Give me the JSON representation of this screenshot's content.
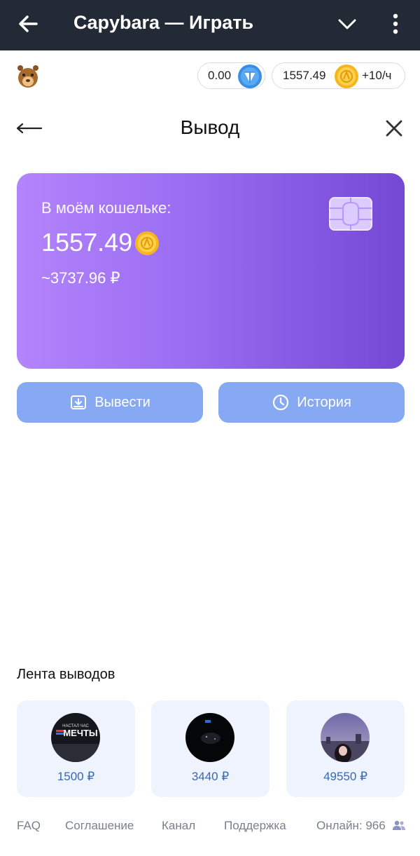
{
  "appbar": {
    "title": "Capybara — Играть"
  },
  "balances": {
    "ton": "0.00",
    "coins": "1557.49",
    "rate": "+10/ч"
  },
  "section": {
    "title": "Вывод"
  },
  "wallet": {
    "label": "В моём кошельке:",
    "amount": "1557.49",
    "rub": "~3737.96 ₽"
  },
  "actions": {
    "withdraw": "Вывести",
    "history": "История"
  },
  "feed": {
    "title": "Лента выводов",
    "items": [
      {
        "amount": "1500 ₽",
        "avatar_text_top": "НАСТАЛ ЧАС",
        "avatar_text": "МЕЧТЫ"
      },
      {
        "amount": "3440 ₽"
      },
      {
        "amount": "49550 ₽"
      }
    ]
  },
  "footer": {
    "faq": "FAQ",
    "agreement": "Соглашение",
    "channel": "Канал",
    "support": "Поддержка",
    "online": "Онлайн: 966"
  },
  "colors": {
    "appbar": "#222b35",
    "card_start": "#b384fb",
    "card_end": "#7548d4",
    "button": "#87a9f4",
    "feed_amount": "#3569b8"
  }
}
